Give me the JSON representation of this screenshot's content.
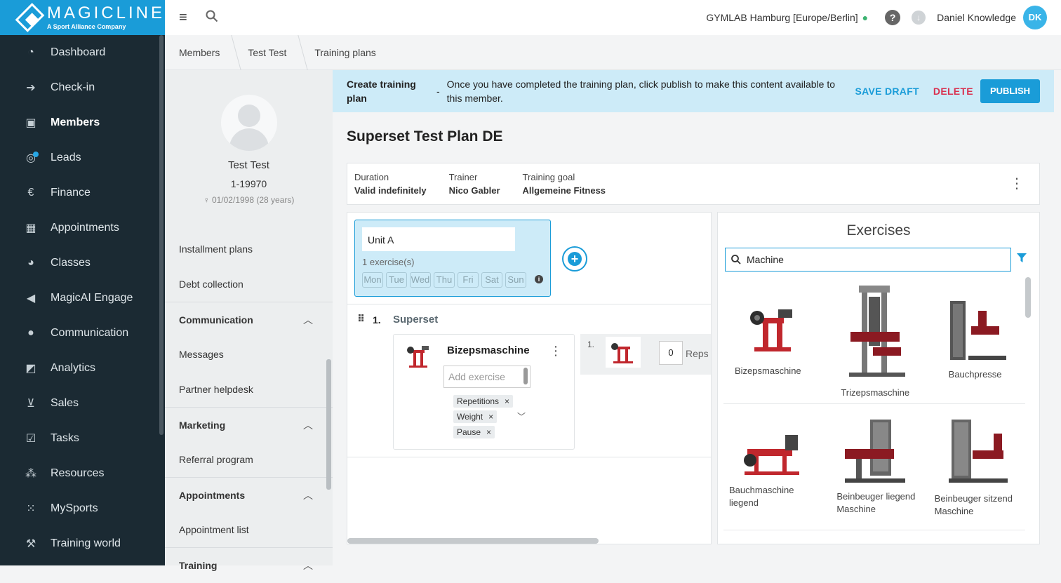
{
  "brand": {
    "name": "MAGICLINE",
    "tagline": "A Sport Alliance Company"
  },
  "nav": [
    {
      "label": "Dashboard",
      "icon": "dashboard-icon"
    },
    {
      "label": "Check-in",
      "icon": "check-in-icon"
    },
    {
      "label": "Members",
      "icon": "members-icon",
      "active": true
    },
    {
      "label": "Leads",
      "icon": "leads-icon"
    },
    {
      "label": "Finance",
      "icon": "euro-icon"
    },
    {
      "label": "Appointments",
      "icon": "calendar-icon"
    },
    {
      "label": "Classes",
      "icon": "classes-icon"
    },
    {
      "label": "MagicAI Engage",
      "icon": "megaphone-icon"
    },
    {
      "label": "Communication",
      "icon": "chat-icon"
    },
    {
      "label": "Analytics",
      "icon": "analytics-icon"
    },
    {
      "label": "Sales",
      "icon": "cart-icon"
    },
    {
      "label": "Tasks",
      "icon": "checkbox-icon"
    },
    {
      "label": "Resources",
      "icon": "resources-icon"
    },
    {
      "label": "MySports",
      "icon": "mysports-icon"
    },
    {
      "label": "Training world",
      "icon": "dumbbell-icon"
    }
  ],
  "topbar": {
    "studio": "GYMLAB Hamburg [Europe/Berlin]",
    "user": "Daniel Knowledge",
    "initials": "DK"
  },
  "breadcrumb": [
    "Members",
    "Test Test",
    "Training plans"
  ],
  "member": {
    "name": "Test Test",
    "id": "1-19970",
    "dob": "01/02/1998 (28 years)"
  },
  "profile_links": [
    "Installment plans",
    "Debt collection"
  ],
  "profile_sections": [
    {
      "title": "Communication",
      "items": [
        "Messages",
        "Partner helpdesk"
      ]
    },
    {
      "title": "Marketing",
      "items": [
        "Referral program"
      ]
    },
    {
      "title": "Appointments",
      "items": [
        "Appointment list"
      ]
    },
    {
      "title": "Training",
      "items": []
    }
  ],
  "banner": {
    "title": "Create training plan",
    "separator": "-",
    "text": "Once you have completed the training plan, click publish to make this content available to this member.",
    "save_draft": "SAVE DRAFT",
    "delete": "DELETE",
    "publish": "PUBLISH"
  },
  "plan": {
    "title": "Superset Test Plan DE",
    "duration_label": "Duration",
    "duration": "Valid indefinitely",
    "trainer_label": "Trainer",
    "trainer": "Nico Gabler",
    "goal_label": "Training goal",
    "goal": "Allgemeine Fitness"
  },
  "unit": {
    "name": "Unit A",
    "count": "1 exercise(s)",
    "days": [
      "Mon",
      "Tue",
      "Wed",
      "Thu",
      "Fri",
      "Sat",
      "Sun"
    ]
  },
  "superset": {
    "number": "1.",
    "label": "Superset",
    "exercise": "Bizepsmaschine",
    "add_placeholder": "Add exercise",
    "chips": [
      "Repetitions",
      "Weight",
      "Pause"
    ],
    "set_number": "1.",
    "reps_value": "0",
    "reps_label": "Reps"
  },
  "exercises_panel": {
    "title": "Exercises",
    "search_value": "Machine",
    "items": [
      "Bizepsmaschine",
      "Trizepsmaschine",
      "Bauchpresse",
      "Bauchmaschine liegend",
      "Beinbeuger liegend Maschine",
      "Beinbeuger sitzend Maschine"
    ]
  },
  "colors": {
    "primary": "#1a9cd8",
    "danger": "#d9304f",
    "nav_bg": "#1b2a33",
    "banner_bg": "#cdebf8"
  }
}
